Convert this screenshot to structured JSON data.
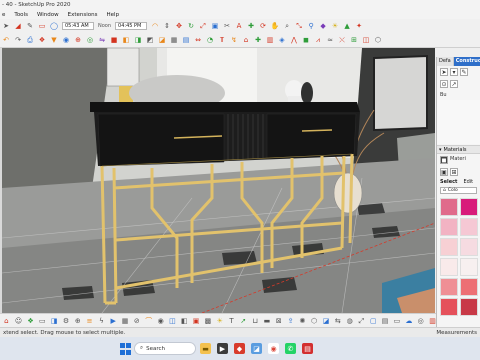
{
  "window": {
    "title": "- 40 - SketchUp Pro 2020"
  },
  "menu": {
    "items": [
      "e",
      "Tools",
      "Window",
      "Extensions",
      "Help"
    ]
  },
  "toolbar": {
    "time_field_1": "05:43 AM",
    "noon_label": "Noon",
    "time_field_2": "04:45 PM",
    "icons_row1": [
      "select-icon",
      "eraser-icon",
      "pencil-icon",
      "rectangle-icon",
      "circle-icon",
      "arc-icon",
      "push-pull-icon",
      "move-icon",
      "rotate-icon",
      "scale-icon",
      "offset-icon",
      "tape-icon",
      "text-icon",
      "axes-icon",
      "orbit-icon",
      "pan-icon",
      "zoom-icon",
      "zoom-extents-icon",
      "walk-icon",
      "section-icon",
      "shadow-icon",
      "fog-icon",
      "sandbox-icon"
    ],
    "icons_row2": [
      "undo-icon",
      "redo-icon",
      "print-icon",
      "component-icon",
      "paint-icon",
      "camera-icon",
      "position-camera-icon",
      "look-around-icon",
      "flip-icon",
      "solid-tools-icon",
      "intersect-icon",
      "union-icon",
      "subtract-icon",
      "trim-icon",
      "split-icon",
      "outer-shell-icon",
      "dimension-icon",
      "protractor-icon",
      "3d-text-icon",
      "follow-me-icon",
      "warehouse-icon",
      "extension-warehouse-icon",
      "layout-icon",
      "style-icon"
    ]
  },
  "panel": {
    "tabs": [
      "Defa",
      "Construction"
    ],
    "label_1": "Bu",
    "materials_title": "Materials",
    "materials_label": "Materi",
    "select_tab": "Select",
    "edit_tab": "Edit",
    "dropdown_value": "Colo",
    "swatch_colors": [
      "#e06b8b",
      "#d81b7a",
      "#f2b3c3",
      "#f5c8d4",
      "#f7d0d4",
      "#f6dbe1",
      "#f9eaea",
      "#f7f0f0",
      "#ef8f95",
      "#ed6f74",
      "#e5515b",
      "#c83947"
    ]
  },
  "bottom_toolbar": {
    "icons": [
      "warehouse-icon",
      "user-icon",
      "components-icon",
      "scenes-icon",
      "sections-icon",
      "settings-icon",
      "add-icon",
      "layers-icon",
      "bolt-icon",
      "play-icon",
      "grid-icon",
      "lock-icon",
      "bridge-icon",
      "camera-icon",
      "x-ray-icon",
      "cube-icon",
      "box-icon",
      "texture-icon",
      "sun-icon",
      "text-icon",
      "arrow-icon",
      "cart-icon",
      "save-icon",
      "plugin-icon",
      "export-icon",
      "render-icon",
      "tag-icon",
      "photo-icon",
      "share-icon",
      "material-icon",
      "flip-icon",
      "frame-icon",
      "paper-icon",
      "ruler-icon",
      "cloud-icon",
      "camera-2-icon",
      "chart-icon"
    ]
  },
  "status": {
    "hint": "xtend select. Drag mouse to select multiple.",
    "measurements_label": "Measurements"
  },
  "taskbar": {
    "search_label": "Search",
    "apps": [
      "explorer-app-icon",
      "media-app-icon",
      "sketchup-app-icon",
      "photo-app-icon",
      "chrome-app-icon",
      "whatsapp-app-icon",
      "pdf-app-icon"
    ]
  }
}
